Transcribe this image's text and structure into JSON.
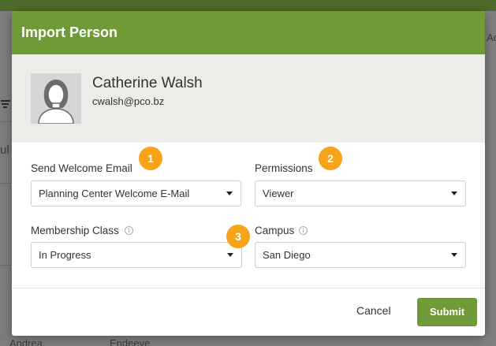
{
  "background": {
    "partial_left_text": "ul",
    "partial_right_text": "Ad",
    "bottom_row": {
      "first": "Andrea",
      "last": "Endeeve"
    }
  },
  "modal": {
    "title": "Import Person",
    "person": {
      "name": "Catherine Walsh",
      "email": "cwalsh@pco.bz"
    },
    "fields": {
      "send_welcome_email": {
        "label": "Send Welcome Email",
        "value": "Planning Center Welcome E-Mail"
      },
      "permissions": {
        "label": "Permissions",
        "value": "Viewer"
      },
      "membership_class": {
        "label": "Membership Class",
        "value": "In Progress"
      },
      "campus": {
        "label": "Campus",
        "value": "San Diego"
      }
    },
    "badges": [
      "1",
      "2",
      "3"
    ],
    "footer": {
      "cancel_label": "Cancel",
      "submit_label": "Submit"
    }
  },
  "colors": {
    "header_green": "#6f9a37",
    "badge_orange": "#f6a31a",
    "person_bg": "#ecede8"
  },
  "icons": [
    "filter-icon",
    "avatar-placeholder-icon",
    "info-icon",
    "caret-down-icon"
  ]
}
